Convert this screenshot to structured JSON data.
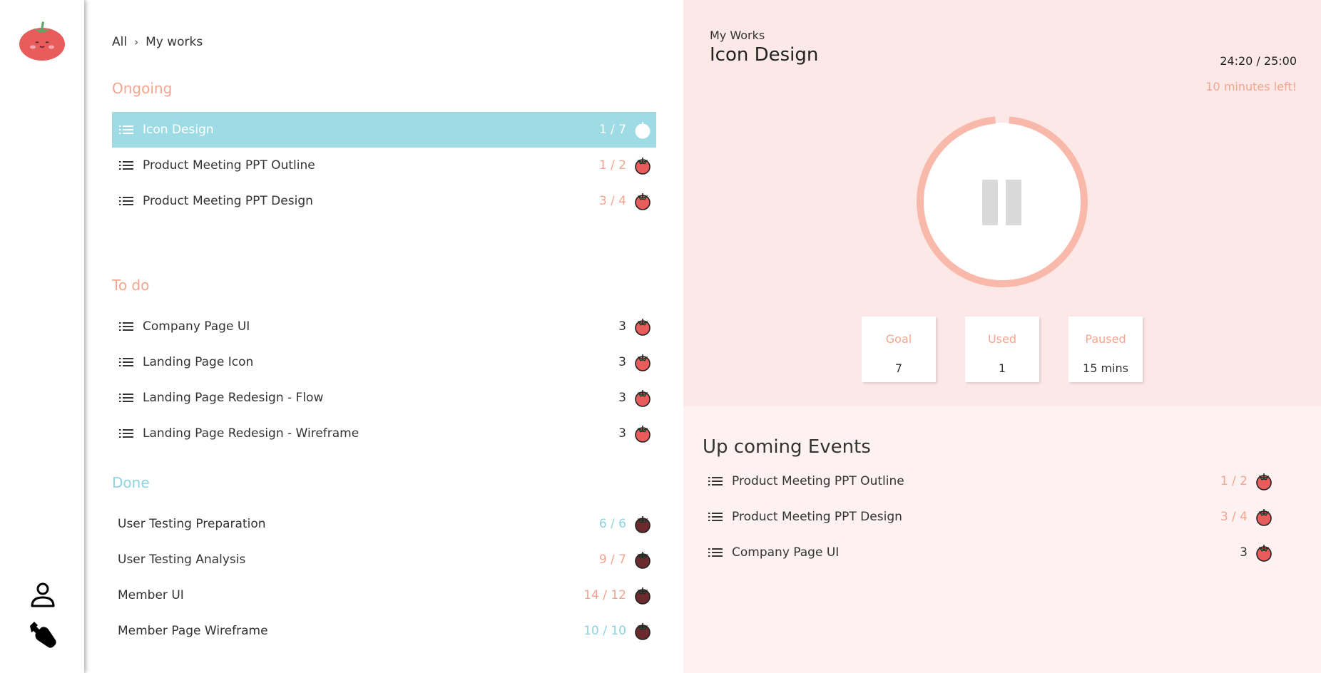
{
  "breadcrumb": {
    "root": "All",
    "current": "My works"
  },
  "sections": {
    "ongoing": "Ongoing",
    "todo": "To do",
    "done": "Done"
  },
  "ongoing": [
    {
      "label": "Icon Design",
      "count": "1 / 7"
    },
    {
      "label": "Product Meeting PPT Outline",
      "count": "1 / 2"
    },
    {
      "label": "Product Meeting PPT Design",
      "count": "3 / 4"
    }
  ],
  "todo": [
    {
      "label": "Company Page UI",
      "count": "3"
    },
    {
      "label": "Landing Page Icon",
      "count": "3"
    },
    {
      "label": "Landing Page Redesign - Flow",
      "count": "3"
    },
    {
      "label": "Landing Page Redesign - Wireframe",
      "count": "3"
    }
  ],
  "done": [
    {
      "label": "User Testing Preparation",
      "count": "6 / 6"
    },
    {
      "label": "User Testing Analysis",
      "count": "9 / 7"
    },
    {
      "label": "Member UI",
      "count": "14 / 12"
    },
    {
      "label": "Member Page Wireframe",
      "count": "10 / 10"
    }
  ],
  "current": {
    "crumb": "My Works",
    "title": "Icon Design",
    "timer": "24:20 / 25:00",
    "time_left": "10 minutes left!",
    "progress": 0.973,
    "state": "paused"
  },
  "stats": {
    "goal_label": "Goal",
    "goal_value": "7",
    "used_label": "Used",
    "used_value": "1",
    "paused_label": "Paused",
    "paused_value": "15 mins"
  },
  "events": {
    "title": "Up coming Events",
    "items": [
      {
        "label": "Product Meeting PPT Outline",
        "count": "1 / 2"
      },
      {
        "label": "Product Meeting PPT Design",
        "count": "3 / 4"
      },
      {
        "label": "Company Page UI",
        "count": "3"
      }
    ]
  },
  "colors": {
    "accent_salmon": "#f4a58e",
    "accent_blue": "#9fdbe5",
    "panel_pink": "#fde8e8",
    "ring": "#f8b9aa",
    "tomato_red": "#e95c5c"
  }
}
